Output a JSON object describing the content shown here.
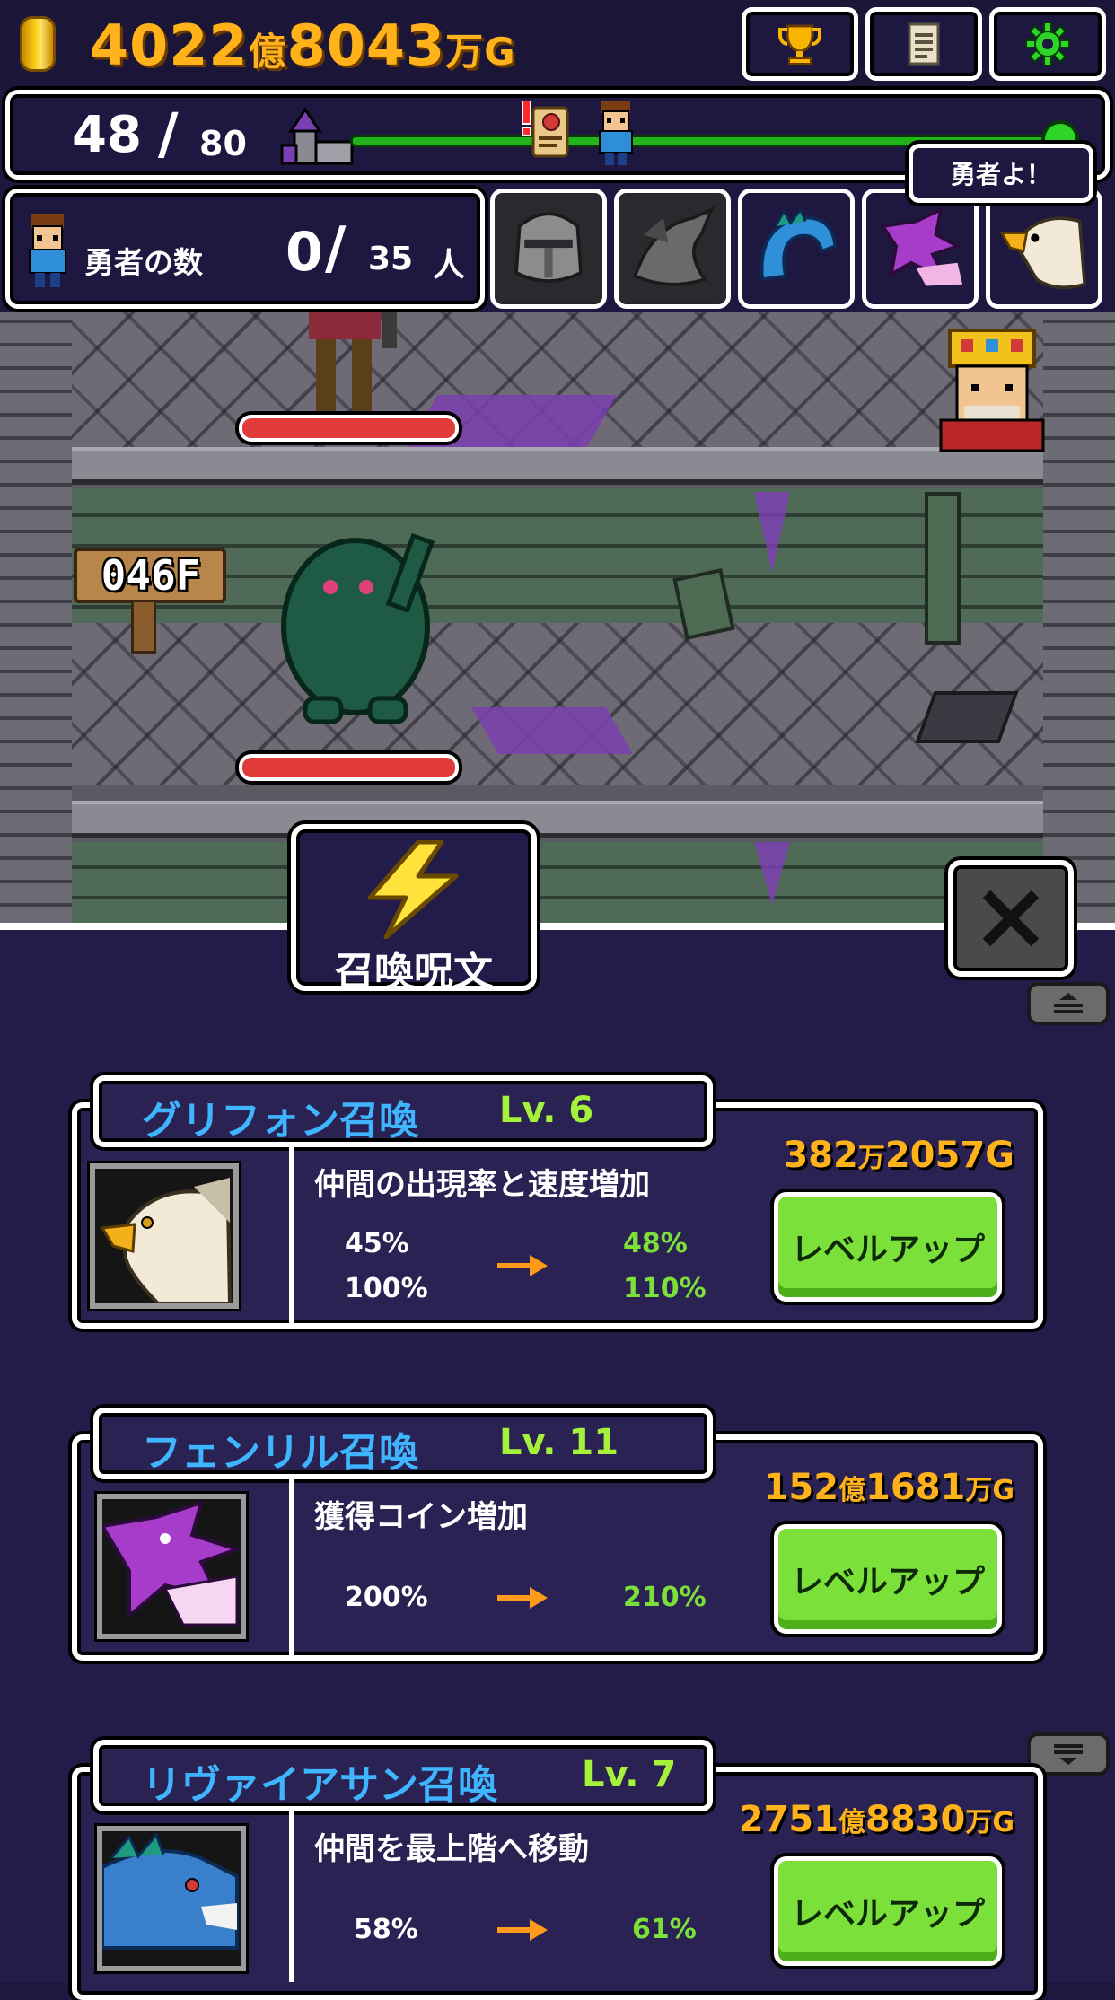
{
  "header": {
    "gold_a": "4022",
    "gold_unit_oku": "億",
    "gold_b": "8043",
    "gold_unit_man": "万",
    "gold_unit_g": "G",
    "buttons": [
      "trophy-icon",
      "document-icon",
      "gear-icon"
    ]
  },
  "progress": {
    "current": "48",
    "slash": "/",
    "max": "80",
    "value": 0.6
  },
  "heroes": {
    "label": "勇者の数",
    "current": "0",
    "slash": "/",
    "max": "35",
    "unit": "人"
  },
  "summons": [
    "knight-icon",
    "dragon-icon",
    "leviathan-icon",
    "fenrir-icon",
    "griffon-icon"
  ],
  "scene": {
    "floor_label": "046F",
    "king_speech": "勇者よ！"
  },
  "menu": {
    "tab_label": "召喚呪文",
    "cards": [
      {
        "name": "グリフォン召喚",
        "level": "Lv. 6",
        "description": "仲間の出現率と速度増加",
        "stats": [
          {
            "from": "45%",
            "to": "48%"
          },
          {
            "from": "100%",
            "to": "110%"
          }
        ],
        "cost_a": "382",
        "cost_u1": "万",
        "cost_b": "2057",
        "cost_u2": "G",
        "button": "レベルアップ"
      },
      {
        "name": "フェンリル召喚",
        "level": "Lv. 11",
        "description": "獲得コイン増加",
        "stats": [
          {
            "from": "200%",
            "to": "210%"
          }
        ],
        "cost_a": "152",
        "cost_u1": "億",
        "cost_b": "1681",
        "cost_u2": "万G",
        "button": "レベルアップ"
      },
      {
        "name": "リヴァイアサン召喚",
        "level": "Lv. 7",
        "description": "仲間を最上階へ移動",
        "stats": [
          {
            "from": "58%",
            "to": "61%"
          }
        ],
        "cost_a": "2751",
        "cost_u1": "億",
        "cost_b": "8830",
        "cost_u2": "万G",
        "button": "レベルアップ"
      }
    ]
  },
  "colors": {
    "background": "#1e1740",
    "gold": "#ffb21a",
    "summon_name": "#3fb5ff",
    "level": "#a6f23a",
    "new_value": "#7ce03a",
    "button_green": "#7be03a",
    "hp_red": "#e23b3b"
  }
}
